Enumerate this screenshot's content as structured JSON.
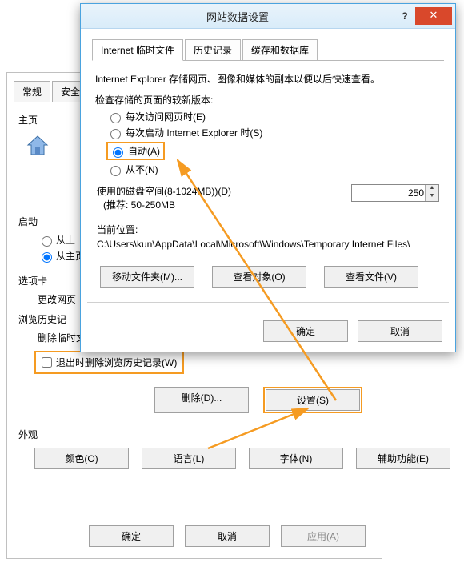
{
  "front_dialog": {
    "title": "网站数据设置",
    "tabs": [
      "Internet 临时文件",
      "历史记录",
      "缓存和数据库"
    ],
    "description": "Internet Explorer 存储网页、图像和媒体的副本以便以后快速查看。",
    "check_newer_label": "检查存储的页面的较新版本:",
    "radios": {
      "every_visit": "每次访问网页时(E)",
      "every_start": "每次启动 Internet Explorer 时(S)",
      "auto": "自动(A)",
      "never": "从不(N)"
    },
    "disk_label": "使用的磁盘空间(8-1024MB))(D)",
    "disk_recommend": "(推荐: 50-250MB",
    "disk_value": "250",
    "location_label": "当前位置:",
    "location_path": "C:\\Users\\kun\\AppData\\Local\\Microsoft\\Windows\\Temporary Internet Files\\",
    "buttons": {
      "move_folder": "移动文件夹(M)...",
      "view_objects": "查看对象(O)",
      "view_files": "查看文件(V)",
      "ok": "确定",
      "cancel": "取消"
    }
  },
  "back_window": {
    "tabs": {
      "general": "常规",
      "security": "安全"
    },
    "sections": {
      "homepage": "主页",
      "startup": "启动",
      "tab_section": "选项卡",
      "change_tabs": "更改网页",
      "browsing_history": "浏览历史记",
      "browsing_desc": "删除临时文件、历史记录、Cookie、保存的密码和网页表单信息。",
      "exit_delete": "退出时删除浏览历史记录(W)",
      "appearance": "外观"
    },
    "startup_radios": {
      "from_last": "从上",
      "from_home": "从主页"
    },
    "buttons": {
      "delete": "删除(D)...",
      "settings": "设置(S)",
      "colors": "颜色(O)",
      "languages": "语言(L)",
      "fonts": "字体(N)",
      "accessibility": "辅助功能(E)",
      "ok": "确定",
      "cancel": "取消",
      "apply": "应用(A)"
    }
  }
}
